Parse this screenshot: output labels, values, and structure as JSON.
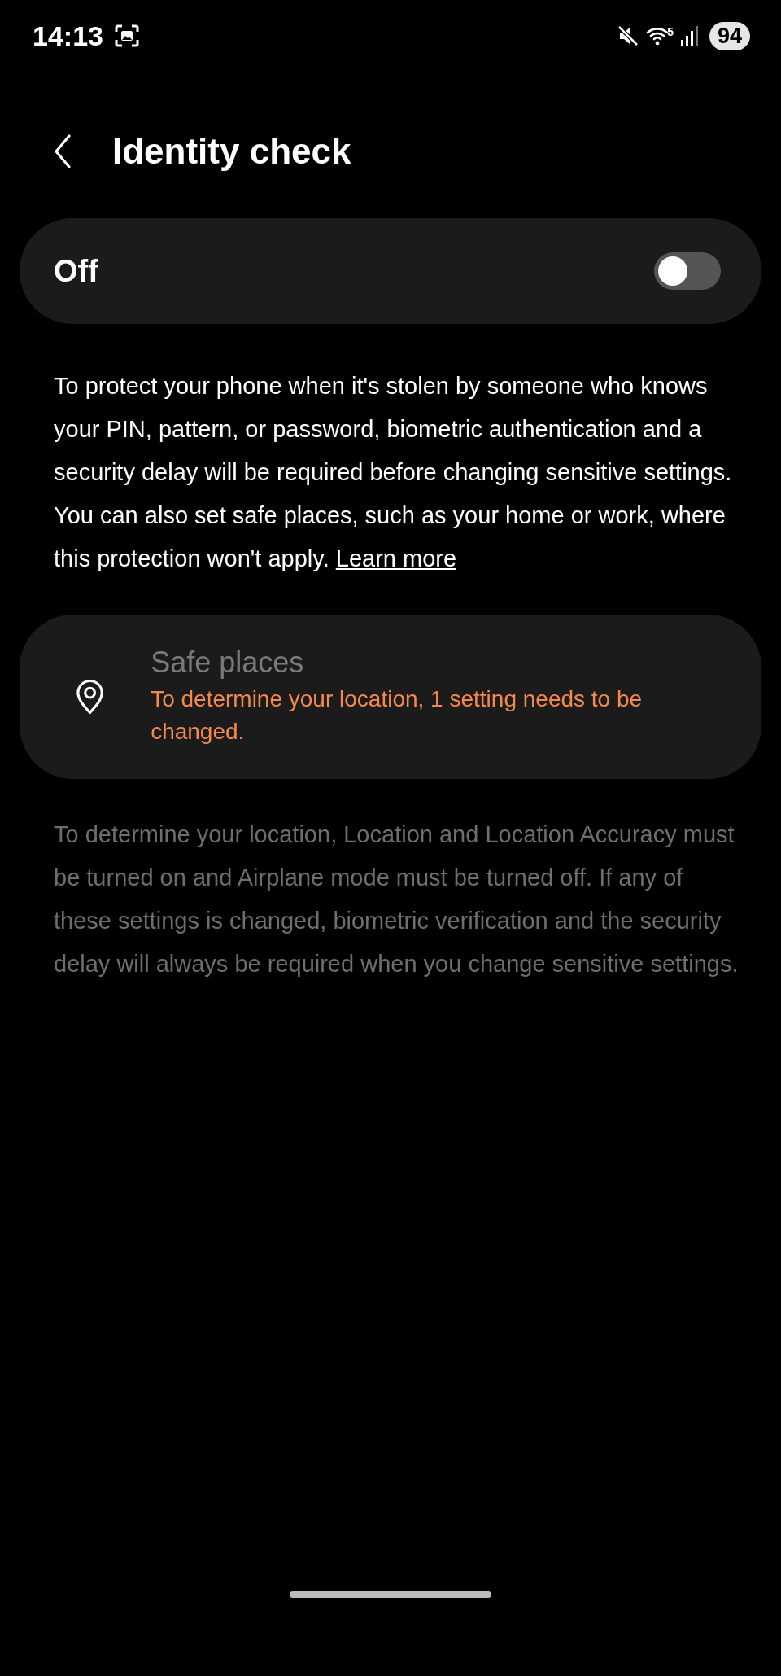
{
  "status_bar": {
    "time": "14:13",
    "network": "5",
    "battery": "94"
  },
  "header": {
    "title": "Identity check"
  },
  "master_switch": {
    "label": "Off",
    "on": false
  },
  "description": {
    "text": "To protect your phone when it's stolen by someone who knows your PIN, pattern, or password, biometric authentication and a security delay will be required before changing sensitive settings. You can also set safe places, such as your home or work, where this protection won't apply.",
    "link": "Learn more"
  },
  "safe_places": {
    "title": "Safe places",
    "warning": "To determine your location, 1 setting needs to be changed.",
    "disabled": true
  },
  "note": "To determine your location, Location and Location Accuracy must be turned on and Airplane mode must be turned off. If any of these settings is changed, biometric verification and the security delay will always be required when you change sensitive settings."
}
